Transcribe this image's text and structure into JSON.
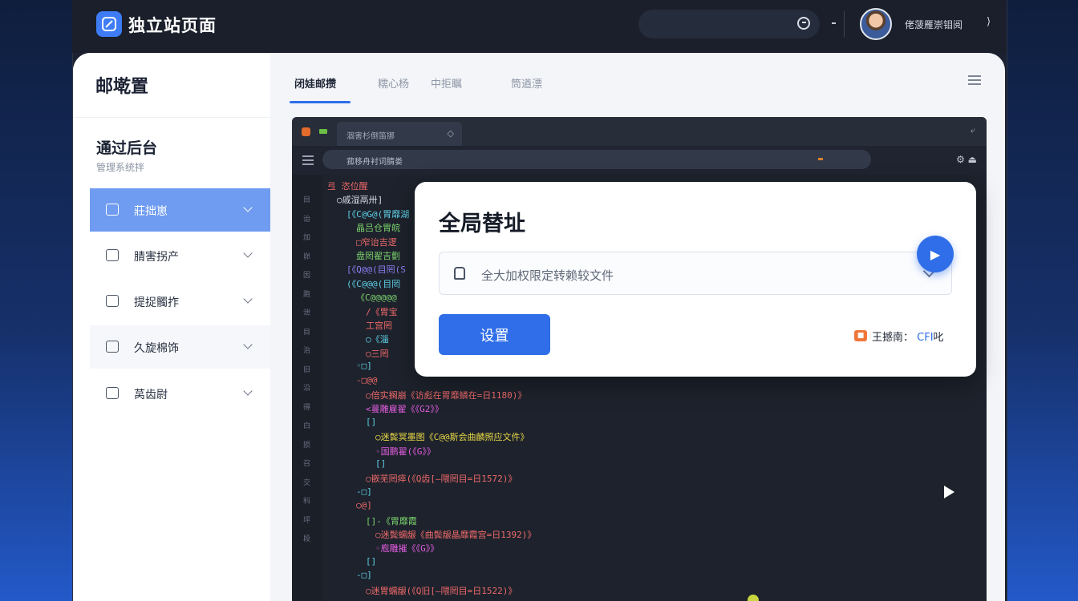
{
  "app": {
    "title": "独立站页面",
    "user_name": "佬菠雁崇钼阅",
    "user_chevron": "⟩"
  },
  "sidebar": {
    "header": "邮墘置",
    "section_title": "通过后台",
    "section_desc": "管理系统拌",
    "items": [
      {
        "label": "莊拙崽",
        "active": true
      },
      {
        "label": "腈害拐产",
        "active": false
      },
      {
        "label": "提捉髑拃",
        "active": false
      },
      {
        "label": "久旋棉饰",
        "active": false
      },
      {
        "label": "莴齿尉",
        "active": false
      }
    ]
  },
  "tabs": [
    {
      "label": "闭娃邮攒",
      "active": true
    },
    {
      "label": "糯心杨",
      "active": false
    },
    {
      "label": "中拒瞩",
      "active": false
    },
    {
      "label": "筒遒漂",
      "active": false
    }
  ],
  "editor": {
    "tab_label": "涸害杉倒笛挪",
    "tab_close": "◇",
    "top_right": "⤶",
    "address": "菰移舟衬词腈娄",
    "address_right": "⚙ ⏏",
    "gutter": [
      "目",
      "诒",
      "加",
      "峁",
      "因",
      "跑",
      "泄",
      "目",
      "治",
      "旧",
      "沿",
      "得",
      "白",
      "损",
      "召",
      "交",
      "科",
      "坪",
      "段"
    ],
    "code_lines": [
      {
        "text": "弖 恣位醒",
        "color": "#ef6a6a",
        "indent": 0
      },
      {
        "text": "○戚湿鬲卅]",
        "color": "#d7dde8",
        "indent": 1
      },
      {
        "text": "[《C@G@(胃靡湖",
        "color": "#5fd0e6",
        "indent": 2
      },
      {
        "text": "晶吕仓胃皖",
        "color": "#7cd36d",
        "indent": 3
      },
      {
        "text": "□窄诒吉逻",
        "color": "#ef6a6a",
        "indent": 3
      },
      {
        "text": "盘罔翟吉劐",
        "color": "#7cd36d",
        "indent": 3
      },
      {
        "text": "[《Q@@(目罔(S",
        "color": "#8f7ff5",
        "indent": 2
      },
      {
        "text": "(《C@@@(目罔",
        "color": "#5fd0e6",
        "indent": 2
      },
      {
        "text": "《C@@@@@",
        "color": "#7cd36d",
        "indent": 3
      },
      {
        "text": "/《胃宝",
        "color": "#ef6a6a",
        "indent": 4
      },
      {
        "text": "工宫罔",
        "color": "#ef6a6a",
        "indent": 4
      },
      {
        "text": "○《淄",
        "color": "#5fd0e6",
        "indent": 4
      },
      {
        "text": "○三罔",
        "color": "#ef6a6a",
        "indent": 4
      },
      {
        "text": "◦□]",
        "color": "#5fd0e6",
        "indent": 3
      },
      {
        "text": "-□@@",
        "color": "#ef6a6a",
        "indent": 3
      },
      {
        "text": "○倍实搁崩《访彪在胃靡鳞在=日1180)》",
        "color": "#ef6a6a",
        "indent": 4
      },
      {
        "text": "<蔓雕雇翟《《G2》》",
        "color": "#e35de0",
        "indent": 4
      },
      {
        "text": "[]",
        "color": "#5fd0e6",
        "indent": 4
      },
      {
        "text": "○迷鬓冥墨图《C@@斯会曲麟照应文件》",
        "color": "#e8d846",
        "indent": 5
      },
      {
        "text": "◦国鹏翟(《G》》",
        "color": "#e35de0",
        "indent": 5
      },
      {
        "text": "[]",
        "color": "#5fd0e6",
        "indent": 5
      },
      {
        "text": "○嵌芜罔瘁(《Q齿[—隈罔目=日1572)》",
        "color": "#ef6a6a",
        "indent": 4
      },
      {
        "text": "-□]",
        "color": "#5fd0e6",
        "indent": 3
      },
      {
        "text": "○@]",
        "color": "#ef6a6a",
        "indent": 3
      },
      {
        "text": "[]-《胃靡霞",
        "color": "#7cd36d",
        "indent": 4
      },
      {
        "text": "○迷鬓蠕龈《曲鬓龈晶靡霞宫=日1392)》",
        "color": "#ef6a6a",
        "indent": 5
      },
      {
        "text": "◦庖雕摧《《G》》",
        "color": "#e35de0",
        "indent": 5
      },
      {
        "text": "[]",
        "color": "#5fd0e6",
        "indent": 4
      },
      {
        "text": "-□]",
        "color": "#5fd0e6",
        "indent": 3
      },
      {
        "text": "○迷胃蠕龈(《Q旧[—隈罔目=日1522)》",
        "color": "#ef6a6a",
        "indent": 4
      }
    ]
  },
  "modal": {
    "title": "全局替址",
    "input_placeholder": "全大加权限定转赖较文件",
    "float_button_label": "▶",
    "set_button": "设置",
    "hint_badge": "■",
    "hint_prefix": "王撼南：",
    "hint_link": "CFI",
    "hint_suffix": "叱"
  },
  "colors": {
    "accent": "#2f6ee8",
    "sidebar_active": "#6f9cf0",
    "editor_bg": "#1d222c",
    "topbar_bg": "#1a1f2b"
  }
}
